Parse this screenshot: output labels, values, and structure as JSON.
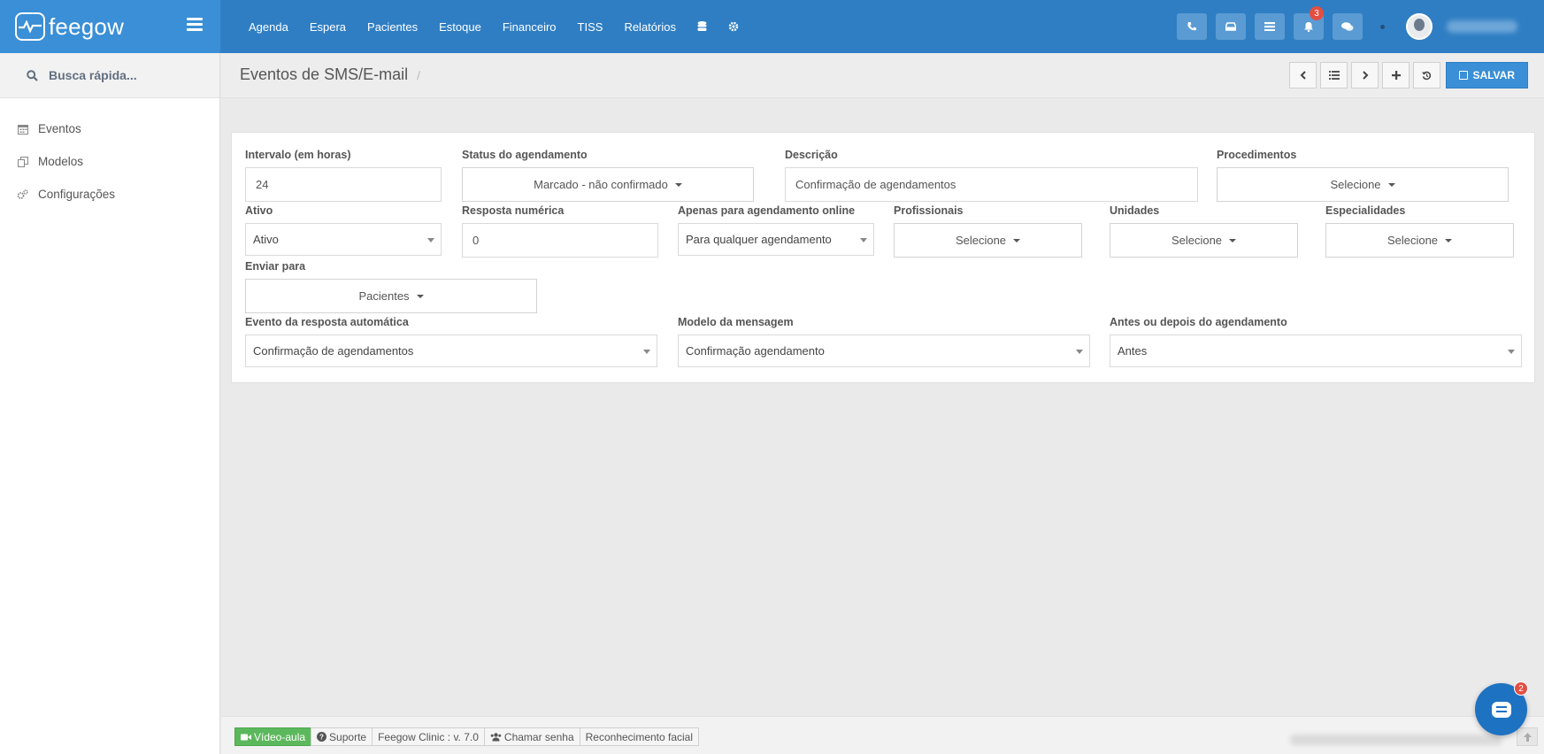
{
  "brand": {
    "name": "feegow"
  },
  "topnav": {
    "items": [
      "Agenda",
      "Espera",
      "Pacientes",
      "Estoque",
      "Financeiro",
      "TISS",
      "Relatórios"
    ],
    "notification_count": "3"
  },
  "sidebar": {
    "search_label": "Busca rápida...",
    "items": [
      "Eventos",
      "Modelos",
      "Configurações"
    ]
  },
  "header": {
    "title": "Eventos de SMS/E-mail",
    "separator": "/",
    "save_label": "SALVAR"
  },
  "form": {
    "intervalo": {
      "label": "Intervalo (em horas)",
      "value": "24"
    },
    "status": {
      "label": "Status do agendamento",
      "value": "Marcado - não confirmado"
    },
    "descricao": {
      "label": "Descrição",
      "value": "Confirmação de agendamentos"
    },
    "procedimentos": {
      "label": "Procedimentos",
      "value": "Selecione"
    },
    "ativo": {
      "label": "Ativo",
      "value": "Ativo"
    },
    "resposta": {
      "label": "Resposta numérica",
      "value": "0"
    },
    "online": {
      "label": "Apenas para agendamento online",
      "value": "Para qualquer agendamento"
    },
    "profissionais": {
      "label": "Profissionais",
      "value": "Selecione"
    },
    "unidades": {
      "label": "Unidades",
      "value": "Selecione"
    },
    "especialidades": {
      "label": "Especialidades",
      "value": "Selecione"
    },
    "enviar": {
      "label": "Enviar para",
      "value": "Pacientes"
    },
    "evento_auto": {
      "label": "Evento da resposta automática",
      "value": "Confirmação de agendamentos"
    },
    "modelo": {
      "label": "Modelo da mensagem",
      "value": "Confirmação agendamento"
    },
    "antes_depois": {
      "label": "Antes ou depois do agendamento",
      "value": "Antes"
    }
  },
  "footer": {
    "video": "Vídeo-aula",
    "suporte": "Suporte",
    "version": "Feegow Clinic : v. 7.0",
    "senha": "Chamar senha",
    "facial": "Reconhecimento facial"
  },
  "chat": {
    "badge": "2"
  },
  "colors": {
    "primary": "#2f7ec3",
    "brand_bg": "#3a8fd6",
    "badge": "#e24e42",
    "video_green": "#5cb85c"
  }
}
